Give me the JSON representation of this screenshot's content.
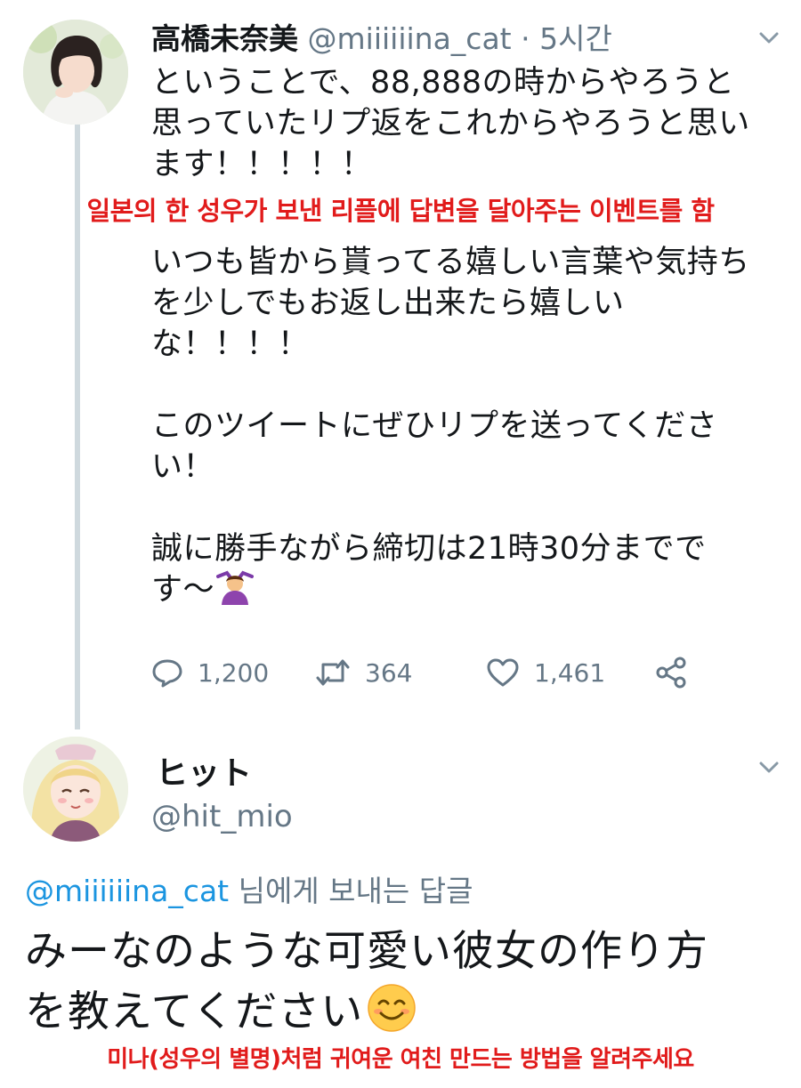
{
  "tweet": {
    "author_name": "高橋未奈美",
    "author_handle": "@miiiiiina_cat",
    "separator": "·",
    "time": "5시간",
    "text_part1": "ということで、88,888の時からやろうと\n思っていたリプ返をこれからやろうと思い\nます！！！！！",
    "text_part2": "いつも皆から貰ってる嬉しい言葉や気持ち\nを少しでもお返し出来たら嬉しい\nな！！！！\n\nこのツイートにぜひリプを送ってくださ\nい！\n\n誠に勝手ながら締切は21時30分までで\nす〜",
    "emoji": "person-gesturing-ok-emoji",
    "reply_count": "1,200",
    "retweet_count": "364",
    "like_count": "1,461"
  },
  "caption1": "일본의 한 성우가 보낸 리플에 답변을 달아주는 이벤트를 함",
  "reply": {
    "author_name": "ヒット",
    "author_handle": "@hit_mio",
    "replying_to_mention": "@miiiiiina_cat",
    "replying_to_suffix": " 님에게 보내는 답글",
    "text": "みーなのような可愛い彼女の作り方\nを教えてください",
    "emoji": "smiling-face-emoji"
  },
  "caption2": "미나(성우의 별명)처럼 귀여운 여친 만드는 방법을 알려주세요",
  "colors": {
    "text": "#14171a",
    "secondary": "#657786",
    "link": "#1b95e0",
    "caption": "#e11b1b",
    "thread_line": "#cfd9de"
  }
}
